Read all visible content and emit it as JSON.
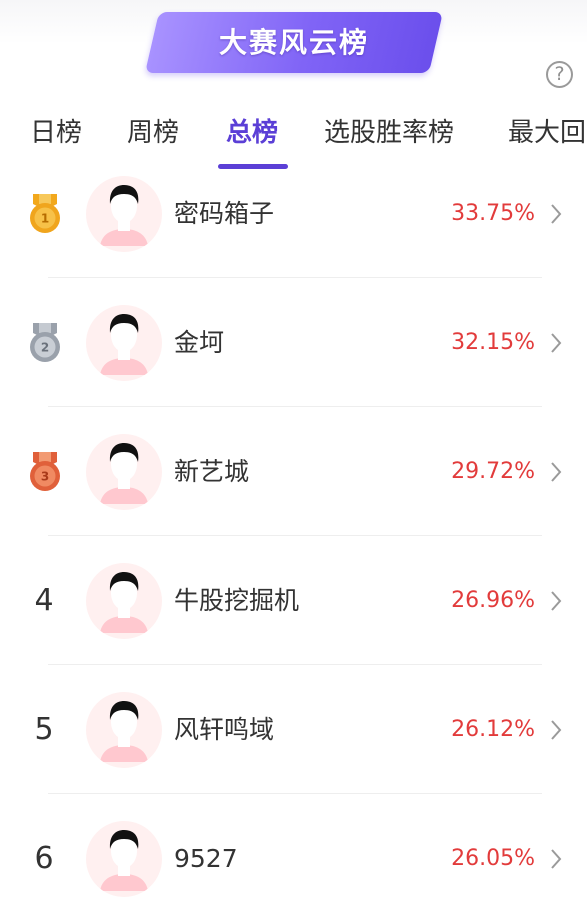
{
  "header": {
    "title": "大赛风云榜",
    "help_label": "?"
  },
  "tabs": [
    {
      "label": "日榜",
      "active": false
    },
    {
      "label": "周榜",
      "active": false
    },
    {
      "label": "总榜",
      "active": true
    },
    {
      "label": "选股胜率榜",
      "active": false
    },
    {
      "label": "最大回",
      "active": false
    }
  ],
  "colors": {
    "accent": "#5b3fd6",
    "rate_red": "#e23b3b",
    "gold": "#f0a51d",
    "silver": "#9aa1ab",
    "bronze": "#e0603a"
  },
  "ranking": [
    {
      "rank": "1",
      "medal": "gold-medal-icon",
      "name": "密码箱子",
      "rate": "33.75%"
    },
    {
      "rank": "2",
      "medal": "silver-medal-icon",
      "name": "金坷",
      "rate": "32.15%"
    },
    {
      "rank": "3",
      "medal": "bronze-medal-icon",
      "name": "新艺城",
      "rate": "29.72%"
    },
    {
      "rank": "4",
      "medal": null,
      "name": "牛股挖掘机",
      "rate": "26.96%"
    },
    {
      "rank": "5",
      "medal": null,
      "name": "风轩鸣域",
      "rate": "26.12%"
    },
    {
      "rank": "6",
      "medal": null,
      "name": "9527",
      "rate": "26.05%"
    }
  ]
}
